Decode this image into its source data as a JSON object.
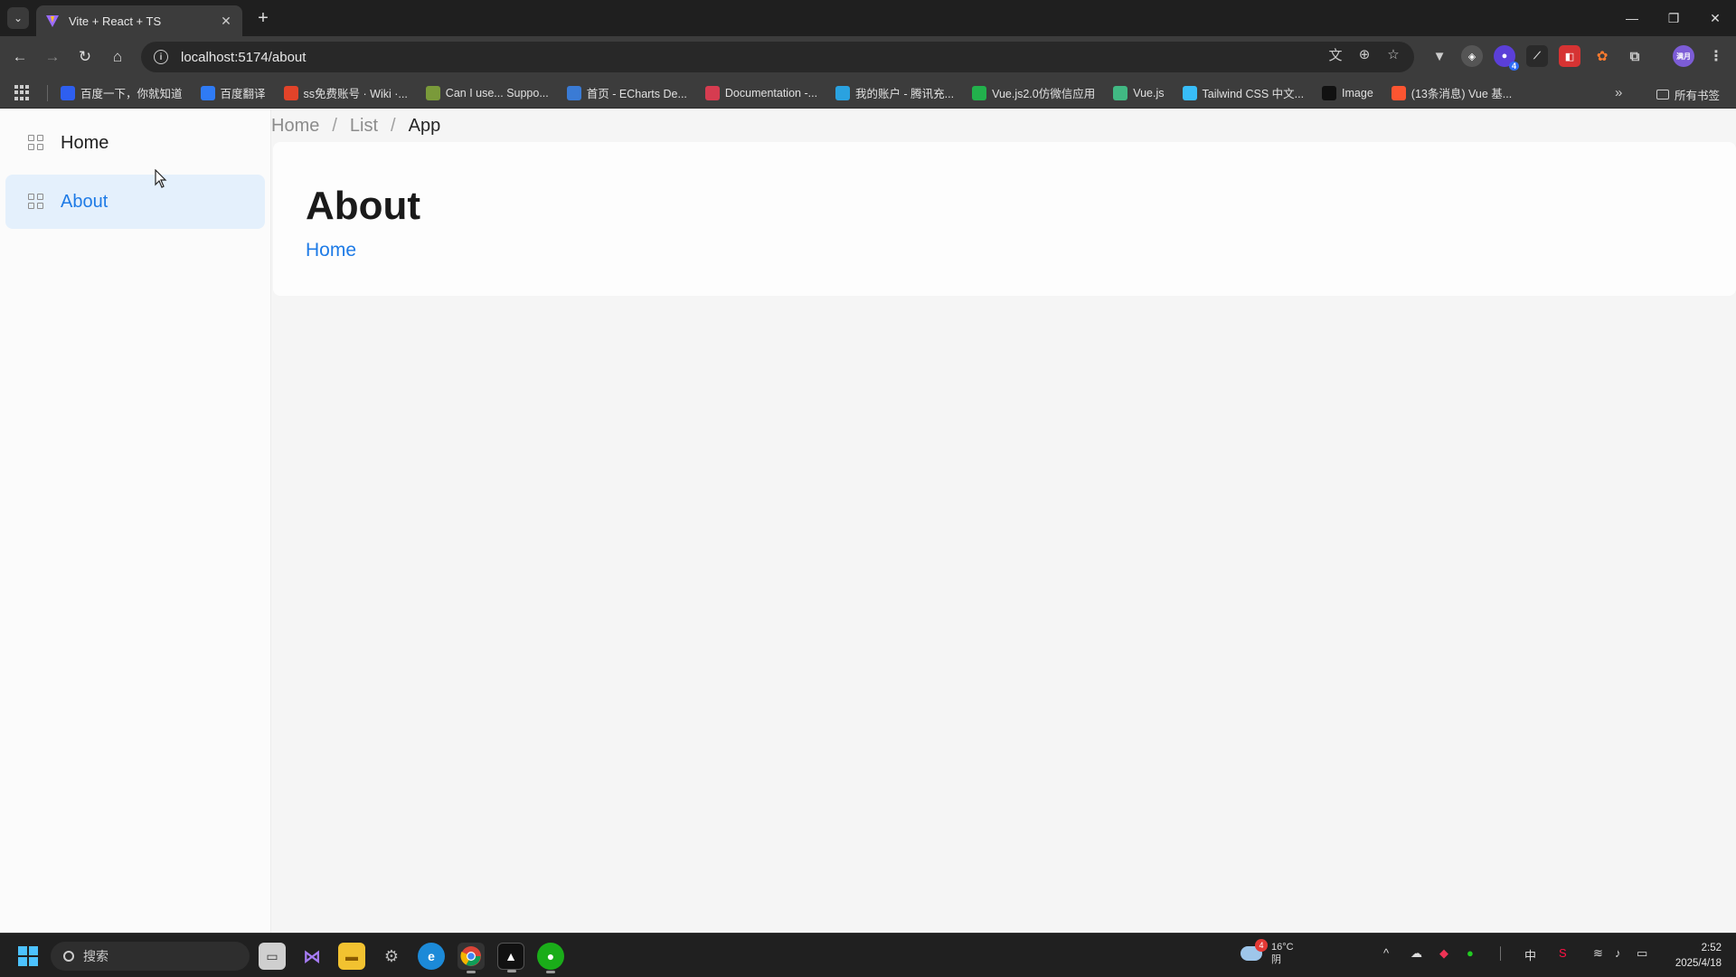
{
  "browser": {
    "tab_title": "Vite + React + TS",
    "url": "localhost:5174/about",
    "profile_label": "满月",
    "extension_badge": "4",
    "bookmarks": [
      {
        "label": "百度一下，你就知道",
        "icon": "baidu-icon",
        "color": "#2e5ff0"
      },
      {
        "label": "百度翻译",
        "icon": "translate-icon",
        "color": "#2f7bf5"
      },
      {
        "label": "ss免费账号 · Wiki ·...",
        "icon": "gitlab-icon",
        "color": "#e24329"
      },
      {
        "label": "Can I use... Suppo...",
        "icon": "caniuse-icon",
        "color": "#7a9a3a"
      },
      {
        "label": "首页 - ECharts De...",
        "icon": "echarts-icon",
        "color": "#3a7bd5"
      },
      {
        "label": "Documentation -...",
        "icon": "docs-icon",
        "color": "#d63c50"
      },
      {
        "label": "我的账户 - 腾讯充...",
        "icon": "tencent-icon",
        "color": "#2aa2e0"
      },
      {
        "label": "Vue.js2.0仿微信应用",
        "icon": "wechat-icon",
        "color": "#22b14c"
      },
      {
        "label": "Vue.js",
        "icon": "vue-icon",
        "color": "#41b883"
      },
      {
        "label": "Tailwind CSS 中文...",
        "icon": "tailwind-icon",
        "color": "#38bdf8"
      },
      {
        "label": "Image",
        "icon": "x-icon",
        "color": "#111111"
      },
      {
        "label": "(13条消息) Vue 基...",
        "icon": "csdn-icon",
        "color": "#fc5531"
      }
    ],
    "all_bookmarks": "所有书签"
  },
  "sidebar": {
    "items": [
      {
        "label": "Home",
        "active": false
      },
      {
        "label": "About",
        "active": true
      }
    ]
  },
  "breadcrumb": {
    "items": [
      "Home",
      "List",
      "App"
    ],
    "separator": "/"
  },
  "content": {
    "title": "About",
    "link_label": "Home"
  },
  "taskbar": {
    "search_placeholder": "搜索",
    "weather_temp": "16°C",
    "weather_desc": "阴",
    "weather_badge": "4",
    "ime": "中",
    "time": "2:52",
    "date": "2025/4/18"
  },
  "colors": {
    "accent": "#1e7be6",
    "active_bg": "#e4f0fc"
  }
}
